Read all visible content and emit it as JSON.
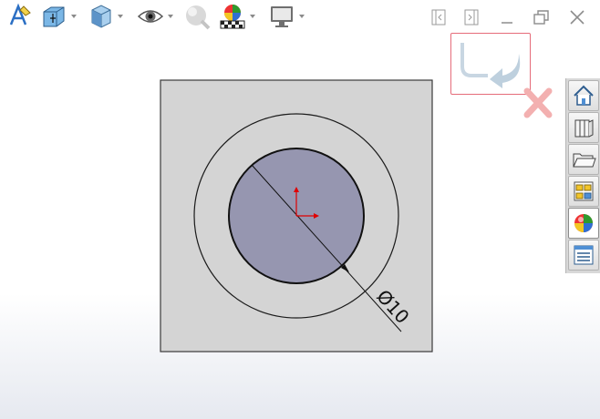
{
  "toolbar": {
    "items": [
      {
        "name": "smart-dimension",
        "icon": "smart-dimension-icon",
        "has_dropdown": false
      },
      {
        "name": "section-view",
        "icon": "section-view-icon",
        "has_dropdown": true
      },
      {
        "name": "view-orientation",
        "icon": "view-orientation-icon",
        "has_dropdown": true
      },
      {
        "name": "hide-show-items",
        "icon": "eye-icon",
        "has_dropdown": true
      },
      {
        "name": "edit-appearance",
        "icon": "appearance-sphere-icon",
        "has_dropdown": false
      },
      {
        "name": "apply-scene",
        "icon": "scene-icon",
        "has_dropdown": true
      },
      {
        "name": "view-settings",
        "icon": "monitor-icon",
        "has_dropdown": true
      }
    ]
  },
  "window_controls": [
    "tile-left-icon",
    "tile-right-icon",
    "minimize-icon",
    "restore-icon",
    "close-icon"
  ],
  "confirmation_corner": {
    "accept_icon": "exit-sketch-icon",
    "cancel_icon": "cancel-x-icon",
    "accent": "#e56c7a"
  },
  "task_pane": {
    "tabs": [
      {
        "name": "resources",
        "icon": "home-icon"
      },
      {
        "name": "design-library",
        "icon": "books-icon"
      },
      {
        "name": "file-explorer",
        "icon": "folder-icon"
      },
      {
        "name": "view-palette",
        "icon": "view-palette-icon"
      },
      {
        "name": "appearances",
        "icon": "appearances-icon",
        "active": true
      },
      {
        "name": "custom-properties",
        "icon": "properties-icon"
      }
    ]
  },
  "sketch": {
    "dimension_text": "Ø10",
    "colors": {
      "plate": "#d4d4d4",
      "fill": "#9696b0",
      "origin": "#e00000"
    }
  }
}
